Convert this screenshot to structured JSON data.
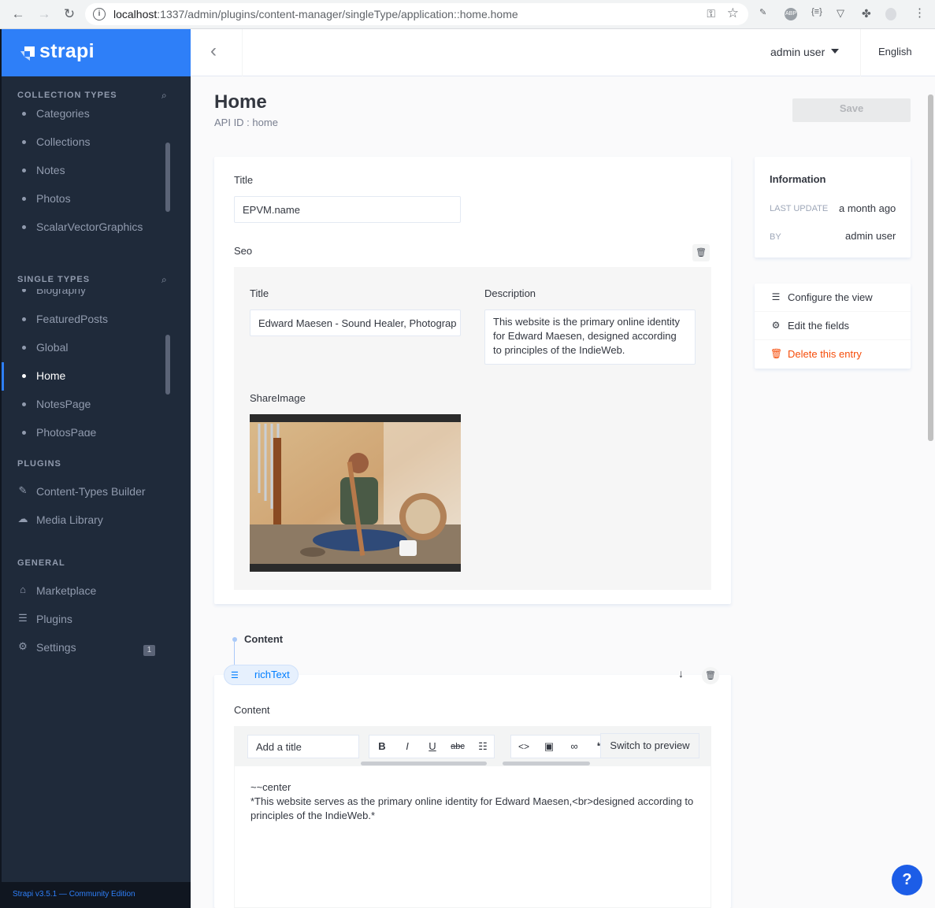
{
  "browser": {
    "url_host": "localhost",
    "url_path": ":1337/admin/plugins/content-manager/singleType/application::home.home"
  },
  "brand": {
    "name": "strapi"
  },
  "sidebar": {
    "collection_title": "Collection Types",
    "collection_items": [
      "Categories",
      "Collections",
      "Notes",
      "Photos",
      "ScalarVectorGraphics"
    ],
    "single_title": "Single Types",
    "single_items": [
      "Biography",
      "FeaturedPosts",
      "Global",
      "Home",
      "NotesPage",
      "PhotosPage"
    ],
    "active_item": "Home",
    "plugins_title": "Plugins",
    "plugins_items": [
      "Content-Types Builder",
      "Media Library"
    ],
    "general_title": "General",
    "general_items": [
      "Marketplace",
      "Plugins",
      "Settings"
    ],
    "settings_badge": "1",
    "footer": "Strapi v3.5.1 — Community Edition"
  },
  "topbar": {
    "user": "admin user",
    "language": "English"
  },
  "header": {
    "title": "Home",
    "subtitle": "API ID : home",
    "save_label": "Save"
  },
  "form": {
    "title_label": "Title",
    "title_value": "EPVM.name",
    "seo_label": "Seo",
    "seo_title_label": "Title",
    "seo_title_value": "Edward Maesen - Sound Healer, Photograp",
    "seo_description_label": "Description",
    "seo_description_value": "This website is the primary online identity for Edward Maesen, designed according to principles of the IndieWeb.",
    "share_image_label": "ShareImage"
  },
  "info": {
    "title": "Information",
    "last_update_label": "Last update",
    "last_update_value": "a month ago",
    "by_label": "By",
    "by_value": "admin user"
  },
  "links": {
    "configure": "Configure the view",
    "edit_fields": "Edit the fields",
    "delete": "Delete this entry"
  },
  "dynamic_zone": {
    "title": "Content",
    "component": "richText",
    "content_label": "Content"
  },
  "editor": {
    "title_placeholder": "Add a title",
    "bold": "B",
    "italic": "I",
    "underline": "U",
    "strike": "abc",
    "switch_label": "Switch to preview",
    "body": "~~center\n*This website serves as the primary online identity for Edward Maesen,<br>designed according to principles of the IndieWeb.*"
  },
  "colors": {
    "primary": "#2e7ff8",
    "sidebar": "#1f2a3a",
    "danger": "#f64d0a"
  }
}
